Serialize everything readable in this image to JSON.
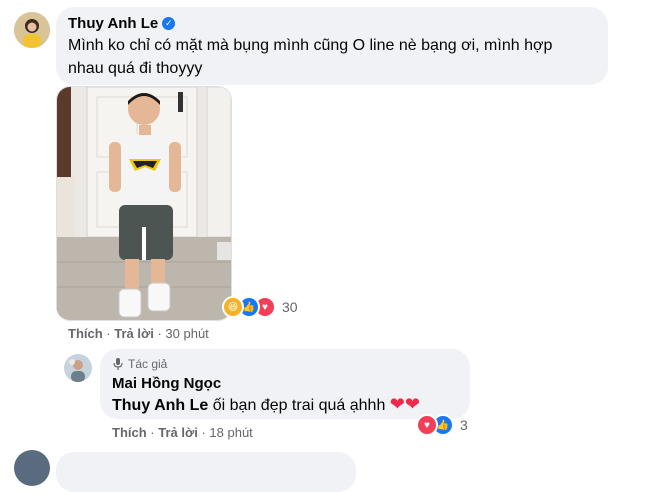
{
  "comment": {
    "author": "Thuy Anh Le",
    "text_line1": "Mình ko chỉ có mặt mà bụng mình cũng O line nè bạng ơi, mình hợp",
    "text_line2": "nhau quá đi thoyyy",
    "reaction_count": "30",
    "action_like": "Thích",
    "action_reply": "Trả lời",
    "time": "30 phút"
  },
  "reply": {
    "badge": "Tác giả",
    "author": "Mai Hồng Ngọc",
    "mention": "Thuy Anh Le",
    "text": "ối bạn đẹp trai quá ạhhh",
    "reaction_count": "3",
    "action_like": "Thích",
    "action_reply": "Trả lời",
    "time": "18 phút"
  },
  "icons": {
    "verified": "verified-badge-icon",
    "laugh": "haha-reaction-icon",
    "like": "like-reaction-icon",
    "love": "love-reaction-icon",
    "author_badge": "microphone-icon"
  },
  "colors": {
    "bubble": "#f0f2f5",
    "like_blue": "#1877f2",
    "love_red": "#f33e58",
    "haha_yellow": "#f7b125"
  }
}
